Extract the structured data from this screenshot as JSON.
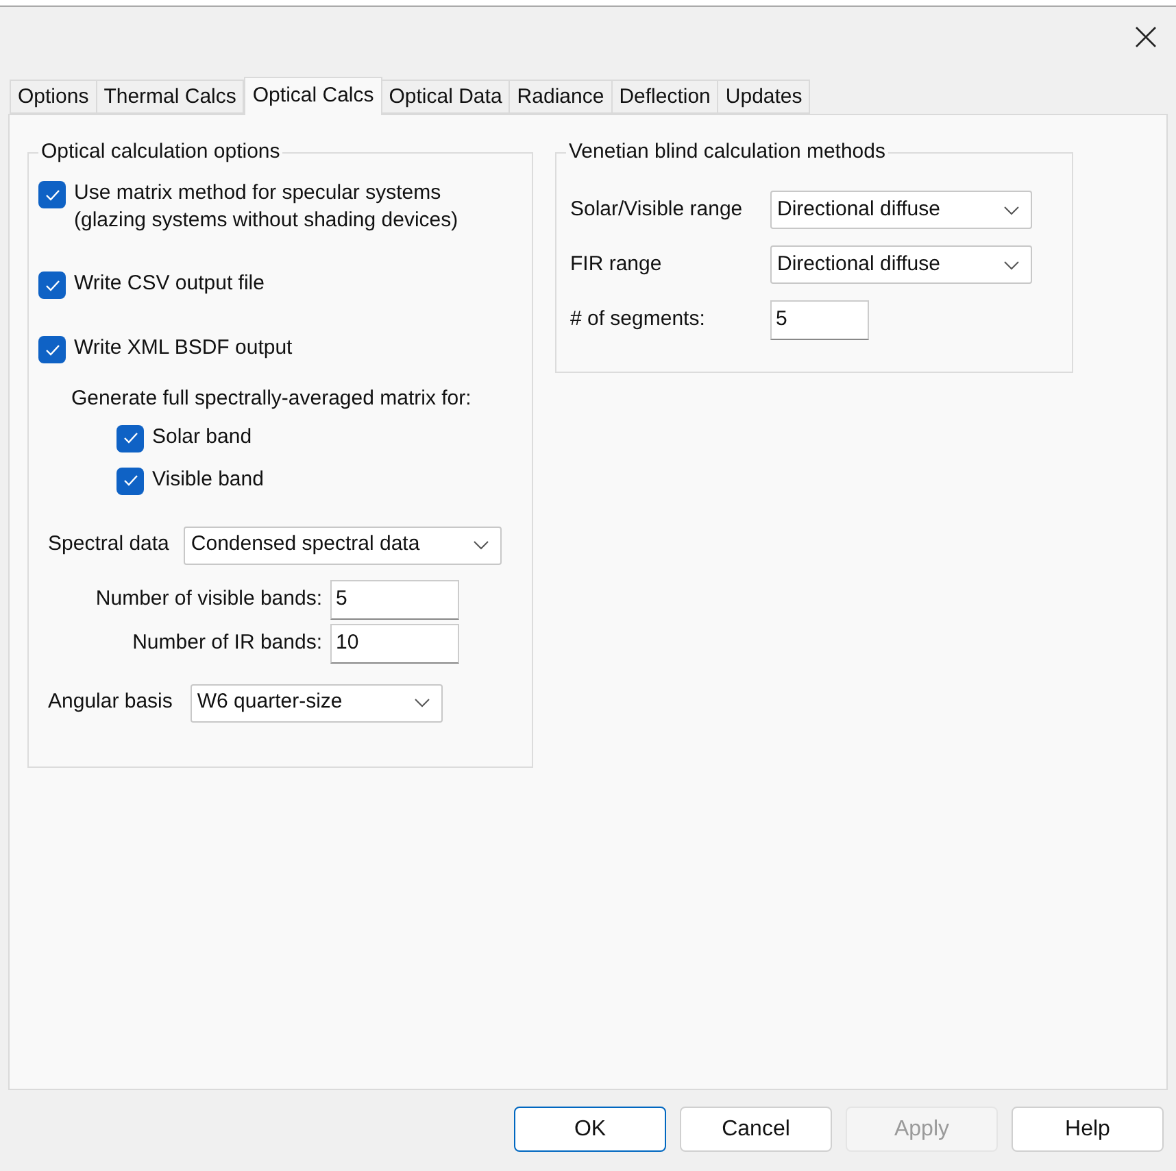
{
  "tabs": [
    {
      "label": "Options",
      "selected": false
    },
    {
      "label": "Thermal Calcs",
      "selected": false
    },
    {
      "label": "Optical Calcs",
      "selected": true
    },
    {
      "label": "Optical Data",
      "selected": false
    },
    {
      "label": "Radiance",
      "selected": false
    },
    {
      "label": "Deflection",
      "selected": false
    },
    {
      "label": "Updates",
      "selected": false
    }
  ],
  "optical_options": {
    "title": "Optical calculation options",
    "checkboxes": [
      {
        "label": "Use matrix method for specular systems",
        "sublabel": "(glazing systems without shading devices)",
        "checked": true
      },
      {
        "label": "Write CSV output file",
        "checked": true
      },
      {
        "label": "Write XML BSDF output",
        "checked": true
      }
    ],
    "matrix_note": "Generate full spectrally-averaged matrix for:",
    "bands": [
      {
        "label": "Solar band",
        "checked": true
      },
      {
        "label": "Visible band",
        "checked": true
      }
    ],
    "spectral_data": {
      "label": "Spectral data",
      "value": "Condensed spectral data"
    },
    "visible_bands": {
      "label": "Number of visible bands:",
      "value": "5"
    },
    "ir_bands": {
      "label": "Number of IR bands:",
      "value": "10"
    },
    "angular_basis": {
      "label": "Angular basis",
      "value": "W6 quarter-size"
    }
  },
  "venetian": {
    "title": "Venetian blind calculation methods",
    "solar_visible": {
      "label": "Solar/Visible range",
      "value": "Directional diffuse"
    },
    "fir": {
      "label": "FIR range",
      "value": "Directional diffuse"
    },
    "segments": {
      "label": "# of segments:",
      "value": "5"
    }
  },
  "buttons": [
    {
      "label": "OK",
      "disabled": false,
      "default": true
    },
    {
      "label": "Cancel",
      "disabled": false,
      "default": false
    },
    {
      "label": "Apply",
      "disabled": true,
      "default": false
    },
    {
      "label": "Help",
      "disabled": false,
      "default": false
    }
  ]
}
